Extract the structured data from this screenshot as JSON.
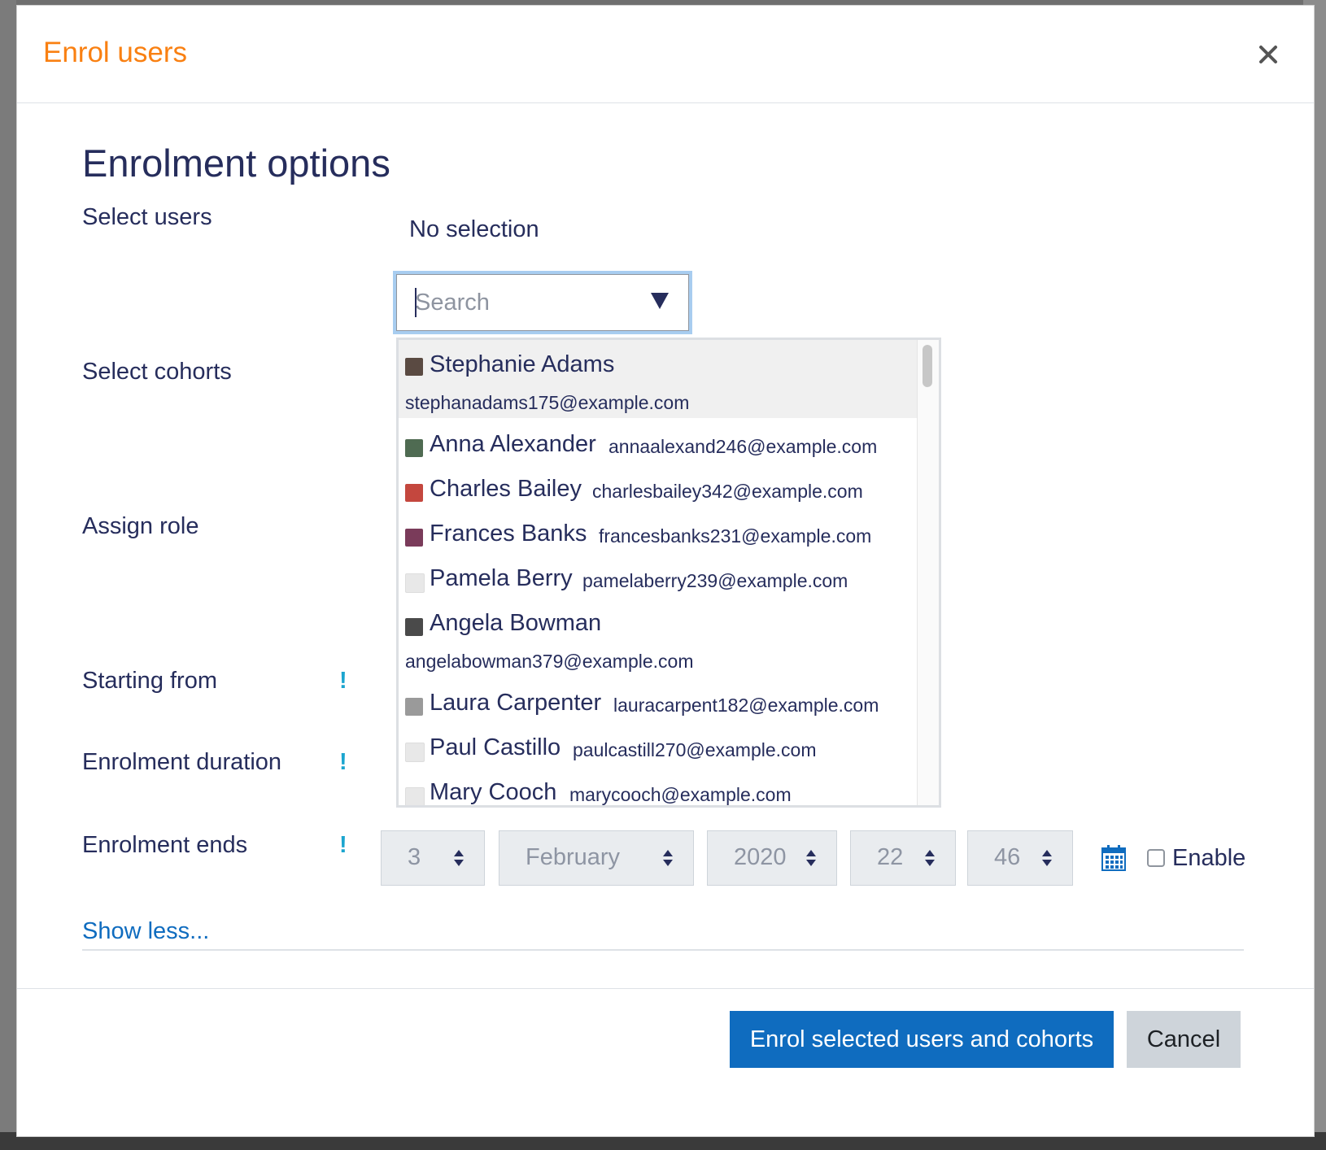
{
  "modal": {
    "title": "Enrol users",
    "section_title": "Enrolment options"
  },
  "form": {
    "select_users_label": "Select users",
    "no_selection": "No selection",
    "search_placeholder": "Search",
    "select_cohorts_label": "Select cohorts",
    "assign_role_label": "Assign role",
    "starting_from_label": "Starting from",
    "enrolment_duration_label": "Enrolment duration",
    "enrolment_ends_label": "Enrolment ends",
    "help_mark": "!",
    "show_less": "Show less...",
    "enable_label": "Enable"
  },
  "users": [
    {
      "name": "Stephanie Adams",
      "email": "stephanadams175@example.com",
      "avatar_color": "#5a4a42"
    },
    {
      "name": "Anna Alexander",
      "email": "annaalexand246@example.com",
      "avatar_color": "#4f6b52"
    },
    {
      "name": "Charles Bailey",
      "email": "charlesbailey342@example.com",
      "avatar_color": "#c4473e"
    },
    {
      "name": "Frances Banks",
      "email": "francesbanks231@example.com",
      "avatar_color": "#7a3b5a"
    },
    {
      "name": "Pamela Berry",
      "email": "pamelaberry239@example.com",
      "avatar_color": "#e8e8e8"
    },
    {
      "name": "Angela Bowman",
      "email": "angelabowman379@example.com",
      "avatar_color": "#4a4a4a"
    },
    {
      "name": "Laura Carpenter",
      "email": "lauracarpent182@example.com",
      "avatar_color": "#9a9a9a"
    },
    {
      "name": "Paul Castillo",
      "email": "paulcastill270@example.com",
      "avatar_color": "#e8e8e8"
    },
    {
      "name": "Mary Cooch",
      "email": "marycooch@example.com",
      "avatar_color": "#e8e8e8"
    }
  ],
  "enrolment_ends": {
    "day": "3",
    "month": "February",
    "year": "2020",
    "hour": "22",
    "minute": "46",
    "enabled": false
  },
  "buttons": {
    "primary": "Enrol selected users and cohorts",
    "cancel": "Cancel"
  },
  "colors": {
    "title_orange": "#f98012",
    "primary_blue": "#0f6cbf",
    "help_cyan": "#1ba5cf",
    "text_dark": "#262d5c"
  }
}
